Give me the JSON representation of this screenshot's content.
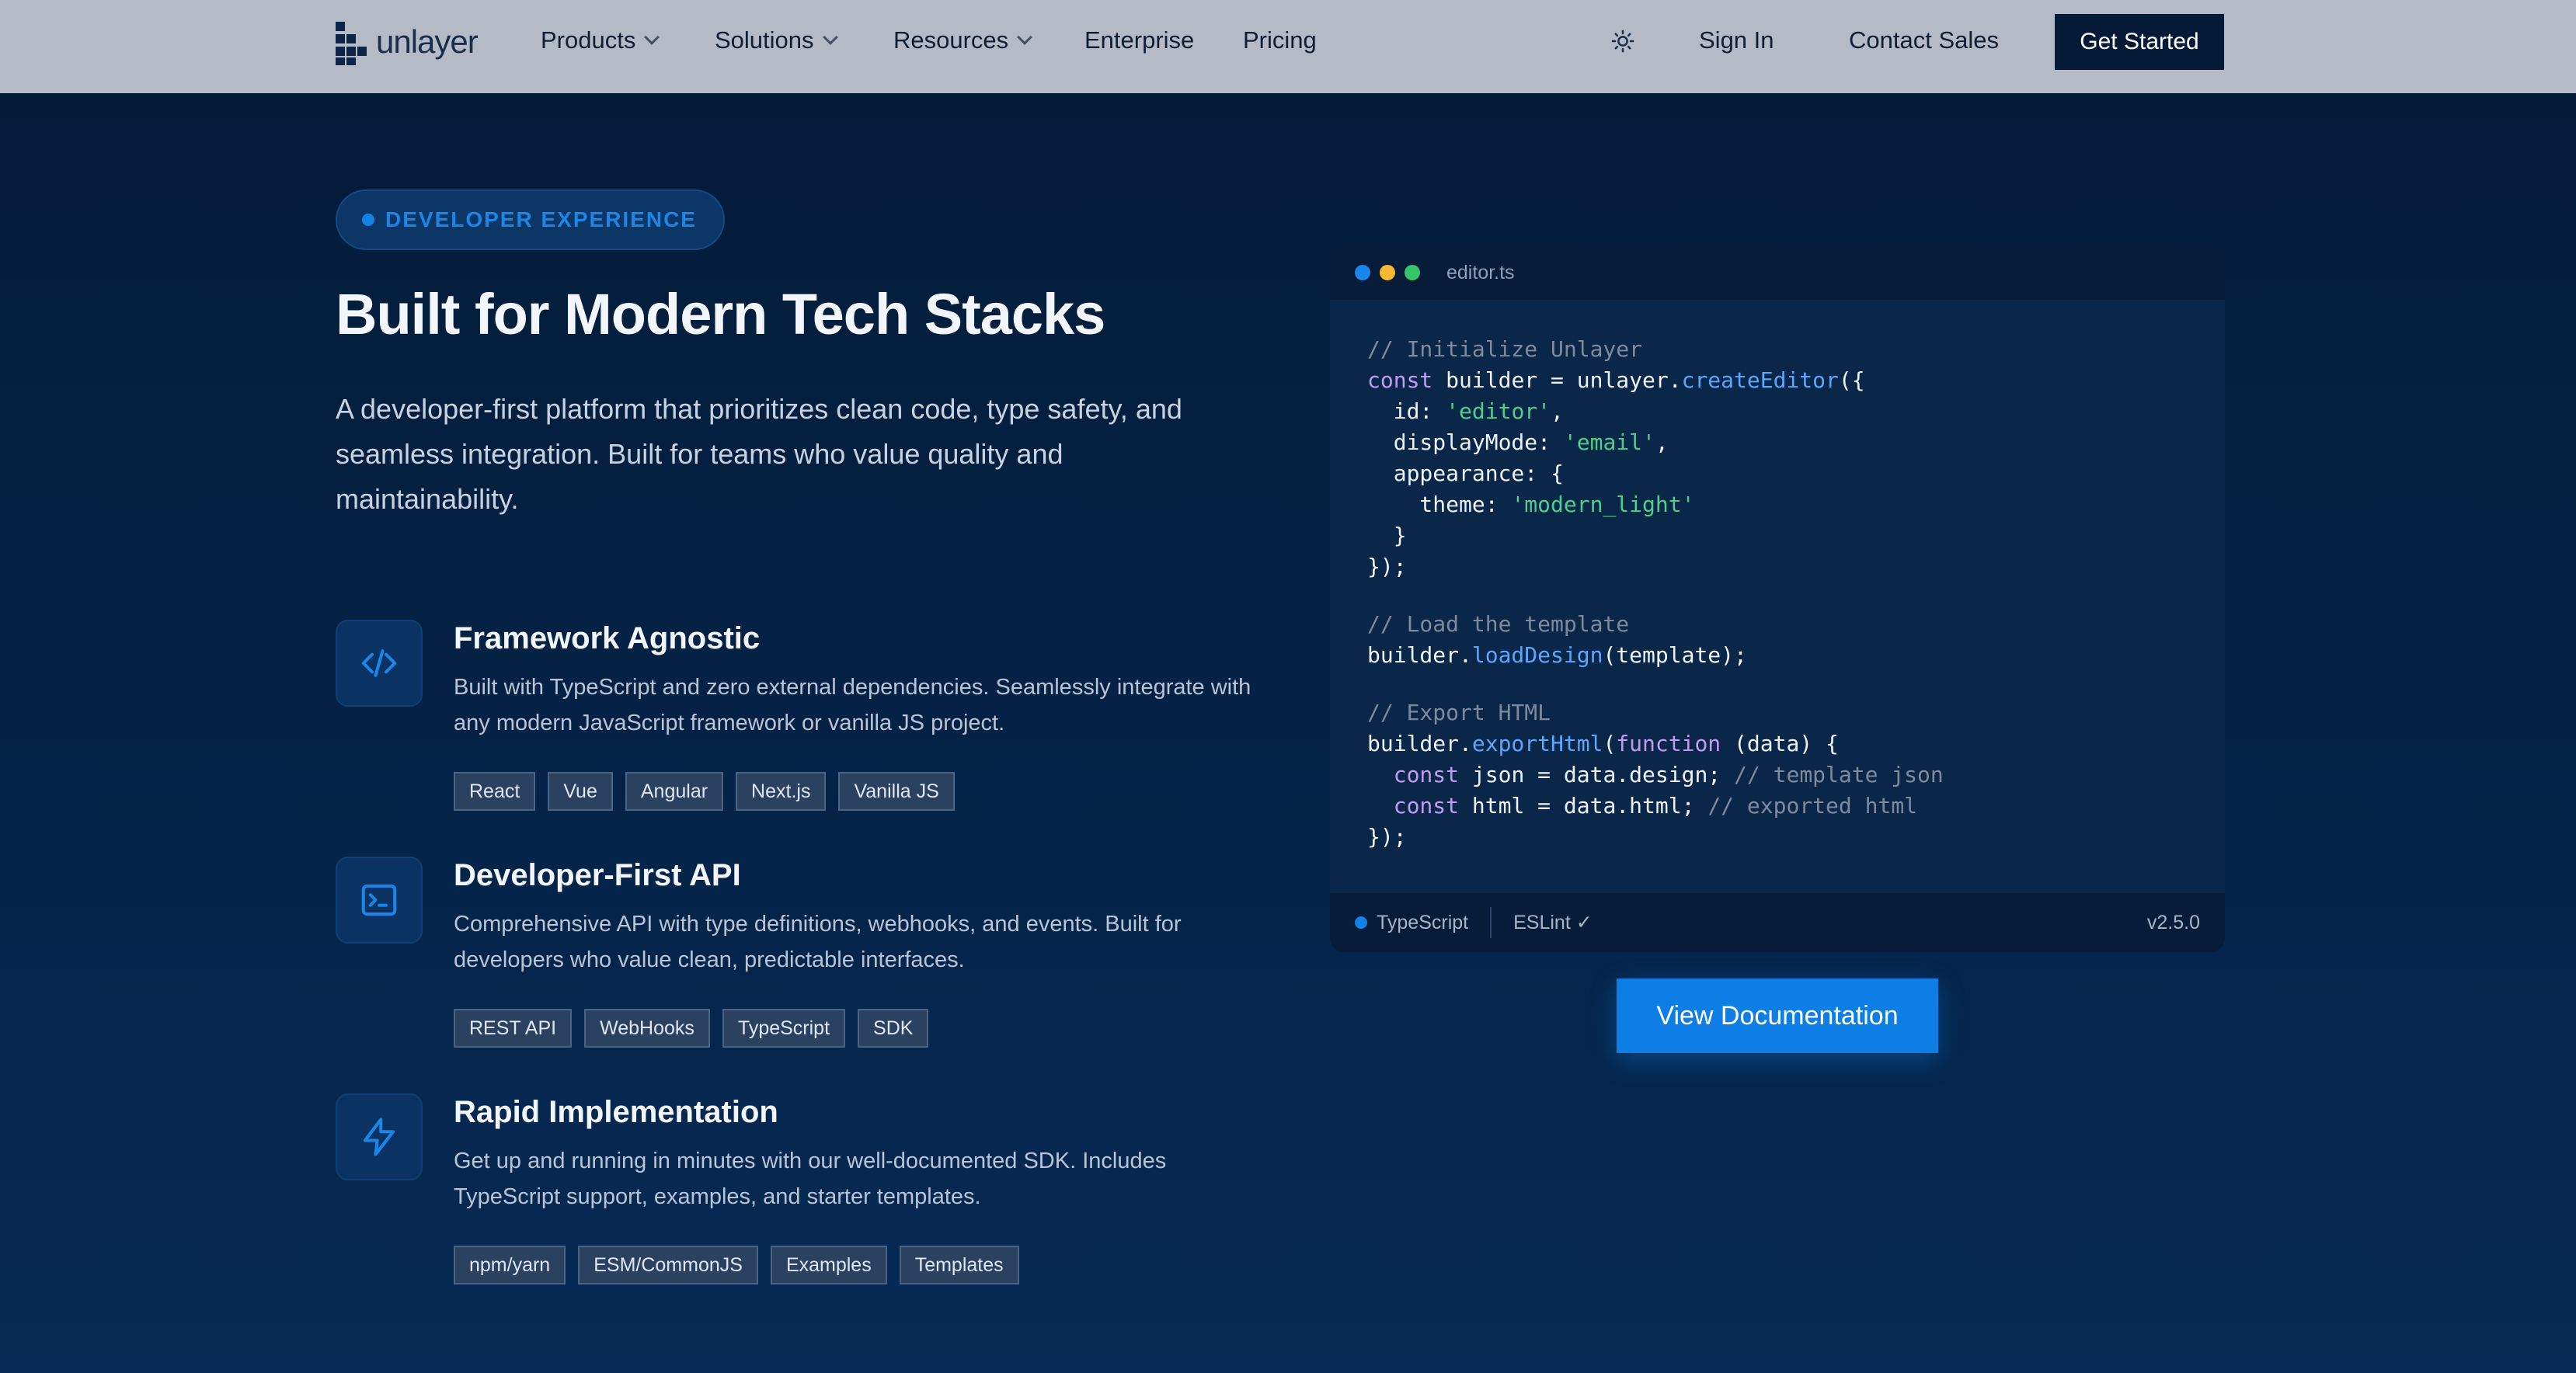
{
  "nav": {
    "logo_text": "unlayer",
    "items": [
      {
        "label": "Products",
        "has_dropdown": true
      },
      {
        "label": "Solutions",
        "has_dropdown": true
      },
      {
        "label": "Resources",
        "has_dropdown": true
      },
      {
        "label": "Enterprise",
        "has_dropdown": false
      },
      {
        "label": "Pricing",
        "has_dropdown": false
      }
    ],
    "theme_icon": "sun-icon",
    "sign_in": "Sign In",
    "contact_sales": "Contact Sales",
    "get_started": "Get Started"
  },
  "hero": {
    "badge": "DEVELOPER EXPERIENCE",
    "title": "Built for Modern Tech Stacks",
    "lead": "A developer-first platform that prioritizes clean code, type safety, and seamless integration. Built for teams who value quality and maintainability."
  },
  "features": [
    {
      "icon": "code-icon",
      "title": "Framework Agnostic",
      "description": "Built with TypeScript and zero external dependencies. Seamlessly integrate with any modern JavaScript framework or vanilla JS project.",
      "tags": [
        "React",
        "Vue",
        "Angular",
        "Next.js",
        "Vanilla JS"
      ]
    },
    {
      "icon": "terminal-icon",
      "title": "Developer-First API",
      "description": "Comprehensive API with type definitions, webhooks, and events. Built for developers who value clean, predictable interfaces.",
      "tags": [
        "REST API",
        "WebHooks",
        "TypeScript",
        "SDK"
      ]
    },
    {
      "icon": "lightning-icon",
      "title": "Rapid Implementation",
      "description": "Get up and running in minutes with our well-documented SDK. Includes TypeScript support, examples, and starter templates.",
      "tags": [
        "npm/yarn",
        "ESM/CommonJS",
        "Examples",
        "Templates"
      ]
    }
  ],
  "editor": {
    "filename": "editor.ts",
    "window_dots": [
      "#1a86e8",
      "#f5b82e",
      "#36c46a"
    ],
    "footer_language": "TypeScript",
    "footer_lint": "ESLint ✓",
    "footer_version": "v2.5.0",
    "code_lines": [
      [
        {
          "t": "// Initialize Unlayer",
          "c": "com"
        }
      ],
      [
        {
          "t": "const",
          "c": "kw"
        },
        {
          "t": " builder = unlayer."
        },
        {
          "t": "createEditor",
          "c": "fn"
        },
        {
          "t": "({"
        }
      ],
      [
        {
          "t": "  id: "
        },
        {
          "t": "'editor'",
          "c": "str"
        },
        {
          "t": ","
        }
      ],
      [
        {
          "t": "  displayMode: "
        },
        {
          "t": "'email'",
          "c": "str"
        },
        {
          "t": ","
        }
      ],
      [
        {
          "t": "  appearance: {"
        }
      ],
      [
        {
          "t": "    theme: "
        },
        {
          "t": "'modern_light'",
          "c": "str"
        }
      ],
      [
        {
          "t": "  }"
        }
      ],
      [
        {
          "t": "});"
        }
      ],
      [
        {
          "t": ""
        }
      ],
      [
        {
          "t": "// Load the template",
          "c": "com"
        }
      ],
      [
        {
          "t": "builder."
        },
        {
          "t": "loadDesign",
          "c": "fn"
        },
        {
          "t": "(template);"
        }
      ],
      [
        {
          "t": ""
        }
      ],
      [
        {
          "t": "// Export HTML",
          "c": "com"
        }
      ],
      [
        {
          "t": "builder."
        },
        {
          "t": "exportHtml",
          "c": "fn"
        },
        {
          "t": "("
        },
        {
          "t": "function",
          "c": "kw"
        },
        {
          "t": " (data) {"
        }
      ],
      [
        {
          "t": "  "
        },
        {
          "t": "const",
          "c": "kw"
        },
        {
          "t": " json = data.design; "
        },
        {
          "t": "// template json",
          "c": "com"
        }
      ],
      [
        {
          "t": "  "
        },
        {
          "t": "const",
          "c": "kw"
        },
        {
          "t": " html = data.html; "
        },
        {
          "t": "// exported html",
          "c": "com"
        }
      ],
      [
        {
          "t": "});"
        }
      ]
    ]
  },
  "cta": {
    "view_docs": "View Documentation"
  },
  "colors": {
    "accent": "#0d7ee6",
    "nav_bg": "#b4bbc6",
    "page_bg": "#041a36"
  }
}
